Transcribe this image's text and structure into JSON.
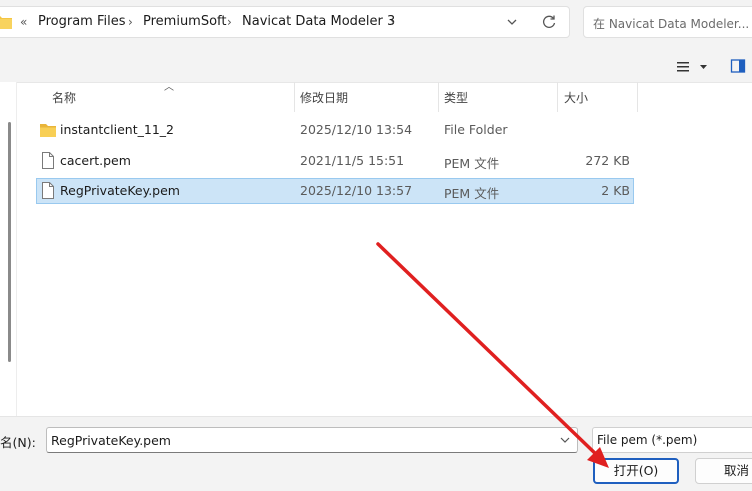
{
  "address_bar": {
    "overflow_glyph": "«",
    "breadcrumbs": [
      "Program Files",
      "PremiumSoft",
      "Navicat Data Modeler 3"
    ],
    "separator": "›",
    "trailing_separator": "›"
  },
  "search": {
    "placeholder": "在 Navicat Data Modeler..."
  },
  "columns": {
    "name": "名称",
    "date": "修改日期",
    "type": "类型",
    "size": "大小"
  },
  "files": [
    {
      "name": "instantclient_11_2",
      "date": "2025/12/10 13:54",
      "type": "File Folder",
      "size": "",
      "icon": "folder-icon",
      "selected": false
    },
    {
      "name": "cacert.pem",
      "date": "2021/11/5 15:51",
      "type": "PEM 文件",
      "size": "272 KB",
      "icon": "file-icon",
      "selected": false
    },
    {
      "name": "RegPrivateKey.pem",
      "date": "2025/12/10 13:57",
      "type": "PEM 文件",
      "size": "2 KB",
      "icon": "file-icon",
      "selected": true
    }
  ],
  "footer": {
    "filename_label": "名(N):",
    "filename_value": "RegPrivateKey.pem",
    "filter_value": "File pem (*.pem)",
    "open_button": "打开(O)",
    "cancel_button": "取消"
  },
  "colors": {
    "selection_bg": "#cce4f7",
    "selection_border": "#99c9ef",
    "primary_button_border": "#1f5fbf",
    "annotation_arrow": "#e02020",
    "folder_yellow": "#f4c542"
  }
}
